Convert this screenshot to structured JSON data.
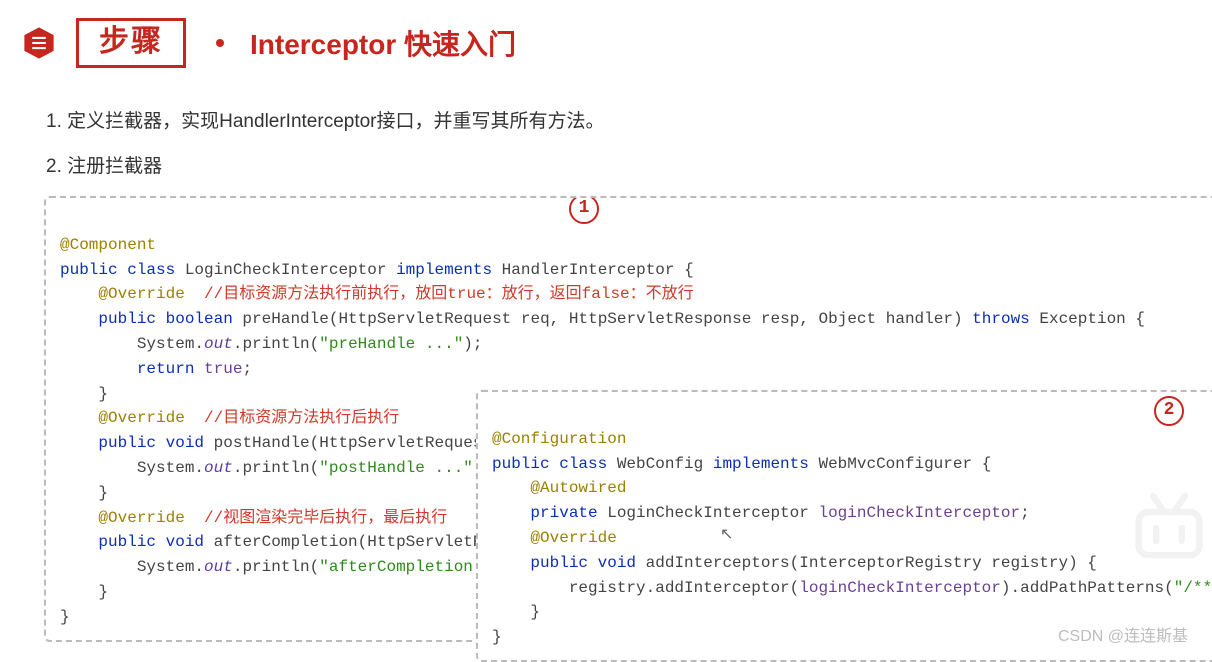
{
  "header": {
    "badge": "步骤",
    "title": "Interceptor 快速入门"
  },
  "steps": [
    "定义拦截器，实现HandlerInterceptor接口，并重写其所有方法。",
    "注册拦截器"
  ],
  "badges": {
    "one": "1",
    "two": "2"
  },
  "code1": {
    "ann_component": "@Component",
    "l2a": "public class",
    "l2b": " LoginCheckInterceptor ",
    "l2c": "implements",
    "l2d": " HandlerInterceptor {",
    "ann_override": "@Override",
    "c1": "//目标资源方法执行前执行，放回true：放行，返回false：不放行",
    "l4a": "public boolean",
    "l4b": " preHandle(HttpServletRequest req, HttpServletResponse resp, Object handler) ",
    "l4c": "throws",
    "l4d": " Exception {",
    "l5a": "        System.",
    "l5b": "out",
    "l5c": ".println(",
    "l5d": "\"preHandle ...\"",
    "l5e": ");",
    "l6a": "return",
    "l6b": " true",
    "l6c": ";",
    "rb": "}",
    "c2": "//目标资源方法执行后执行",
    "l9a": "public void",
    "l9b": " postHandle(HttpServletRequest re",
    "l10a": "        System.",
    "l10b": "out",
    "l10c": ".println(",
    "l10d": "\"postHandle ...\"",
    "l10e": ");",
    "c3": "//视图渲染完毕后执行，最后执行",
    "l13a": "public void",
    "l13b": " afterCompletion(HttpServletReque",
    "l14a": "        System.",
    "l14b": "out",
    "l14c": ".println(",
    "l14d": "\"afterCompletion ...\"",
    "l14e": "",
    "close": "}"
  },
  "code2": {
    "ann_conf": "@Configuration",
    "l2a": "public class",
    "l2b": " WebConfig ",
    "l2c": "implements",
    "l2d": " WebMvcConfigurer {",
    "ann_autow": "@Autowired",
    "l4a": "private",
    "l4b": " LoginCheckInterceptor ",
    "l4c": "loginCheckInterceptor",
    "l4d": ";",
    "ann_override": "@Override",
    "l6a": "public void",
    "l6b": " addInterceptors(InterceptorRegistry registry) {",
    "l7a": "        registry.addInterceptor(",
    "l7b": "loginCheckInterceptor",
    "l7c": ").addPathPatterns(",
    "l7d": "\"/**\"",
    "l7e": ");",
    "rb": "}",
    "close": "}"
  },
  "watermark": "CSDN @连连斯基"
}
